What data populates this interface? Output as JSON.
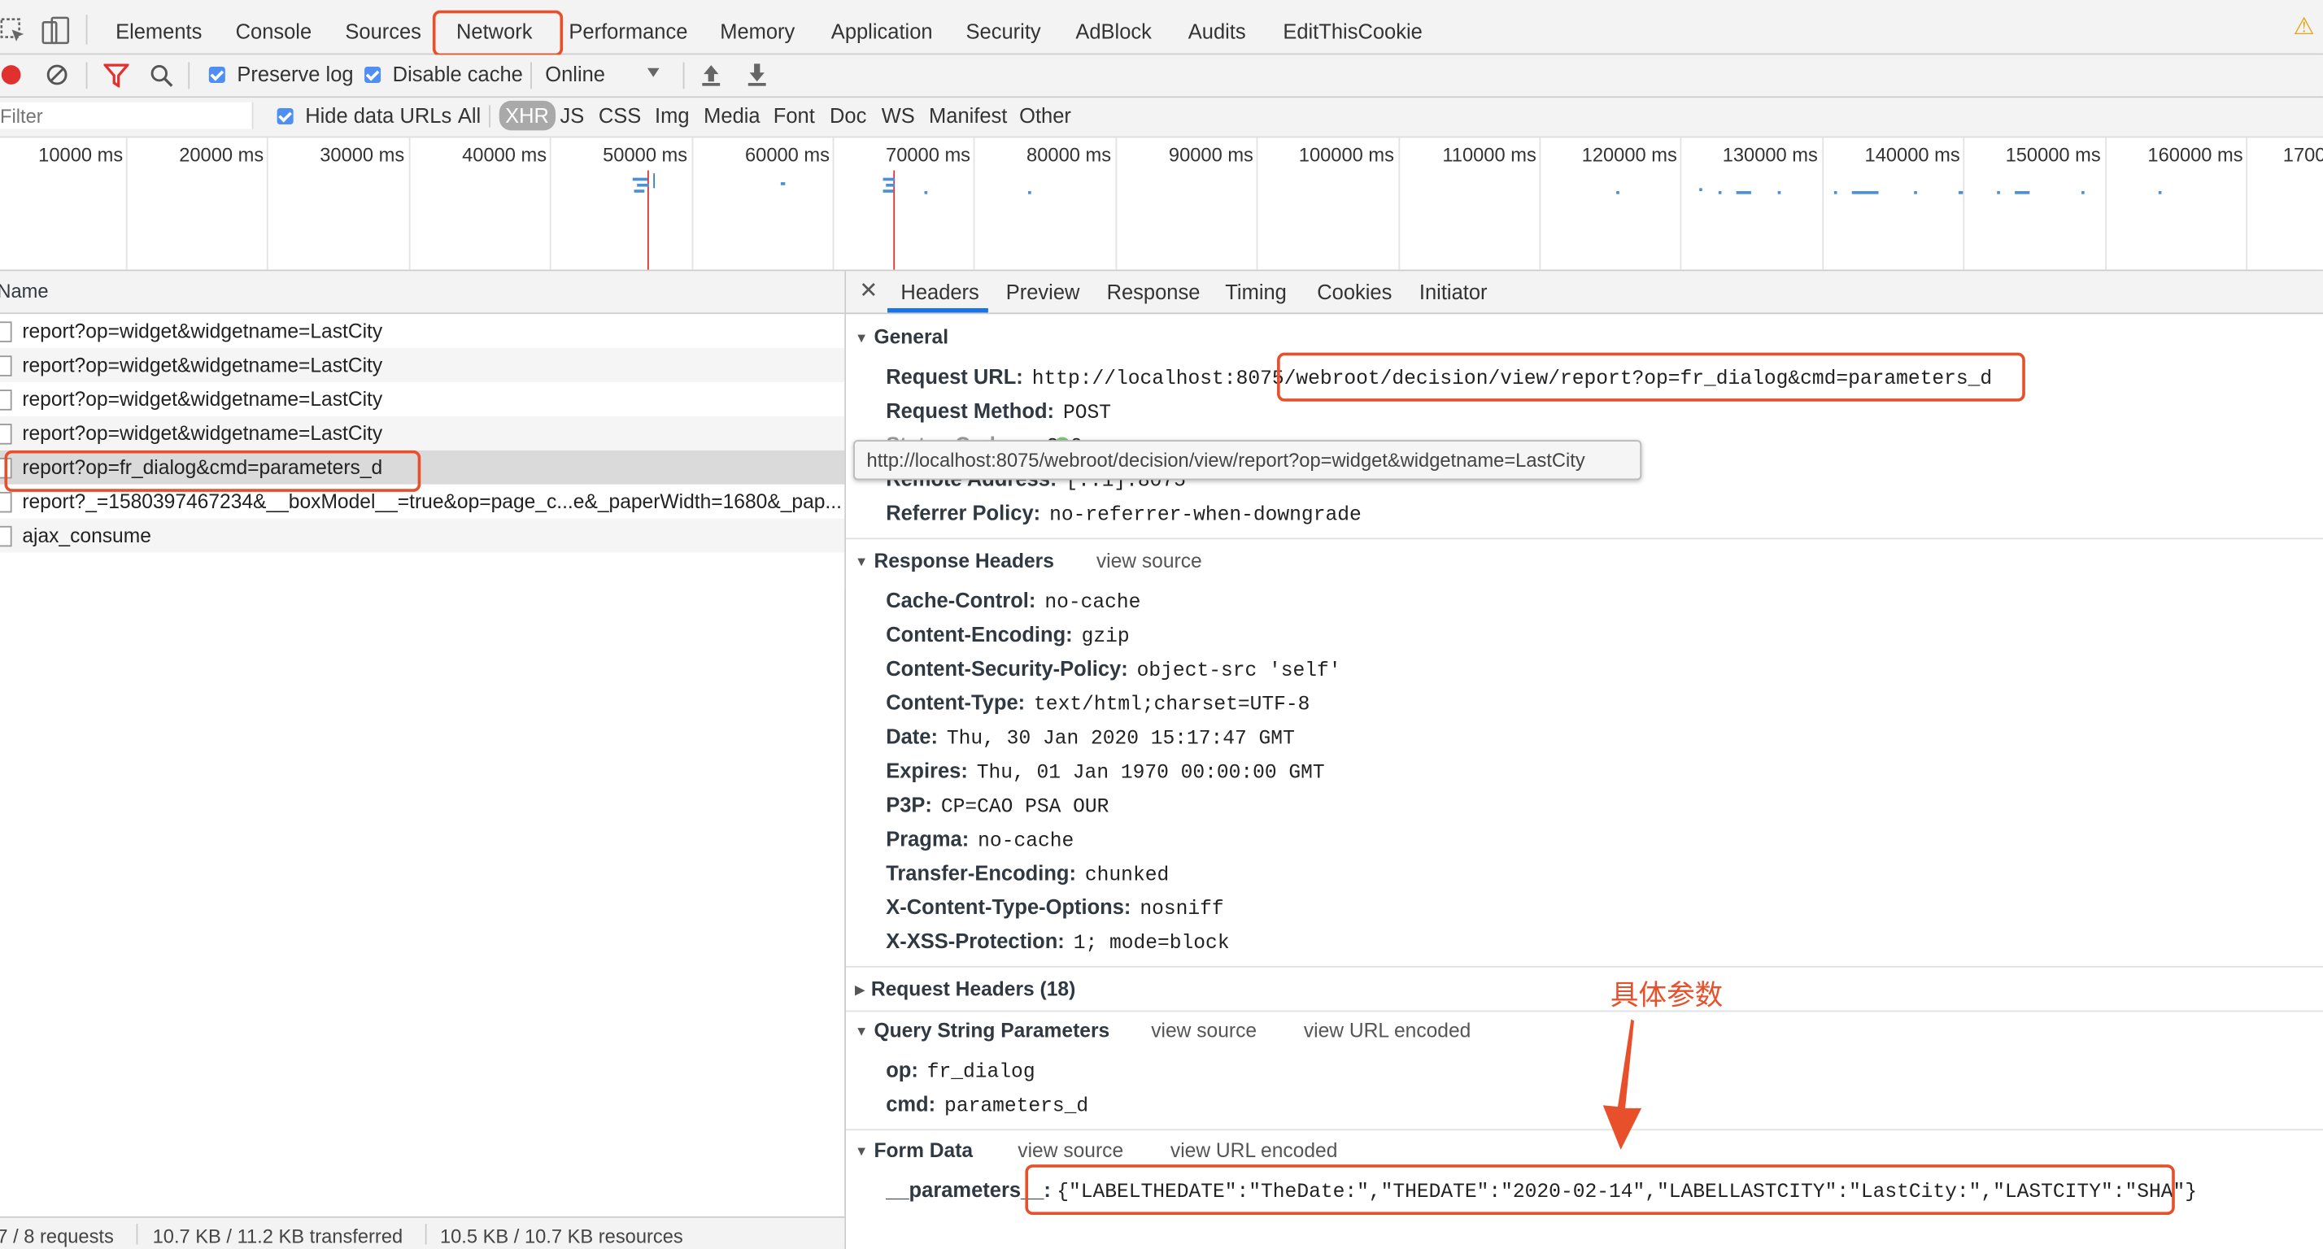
{
  "topbar": {
    "tabs": [
      "Elements",
      "Console",
      "Sources",
      "Network",
      "Performance",
      "Memory",
      "Application",
      "Security",
      "AdBlock",
      "Audits",
      "EditThisCookie"
    ],
    "active_tab": "Network",
    "warning_icon": "⚠"
  },
  "toolbar": {
    "preserve_log": "Preserve log",
    "disable_cache": "Disable cache",
    "throttle": "Online"
  },
  "filterbar": {
    "placeholder": "Filter",
    "hide_data_urls": "Hide data URLs",
    "types": [
      "All",
      "XHR",
      "JS",
      "CSS",
      "Img",
      "Media",
      "Font",
      "Doc",
      "WS",
      "Manifest",
      "Other"
    ],
    "active_type": "XHR"
  },
  "timeline": {
    "ticks": [
      "10000 ms",
      "20000 ms",
      "30000 ms",
      "40000 ms",
      "50000 ms",
      "60000 ms",
      "70000 ms",
      "80000 ms",
      "90000 ms",
      "100000 ms",
      "110000 ms",
      "120000 ms",
      "130000 ms",
      "140000 ms",
      "150000 ms",
      "160000 ms",
      "1700"
    ]
  },
  "requests": {
    "header": "Name",
    "rows": [
      "report?op=widget&widgetname=LastCity",
      "report?op=widget&widgetname=LastCity",
      "report?op=widget&widgetname=LastCity",
      "report?op=widget&widgetname=LastCity",
      "report?op=fr_dialog&cmd=parameters_d",
      "report?_=1580397467234&__boxModel__=true&op=page_c...e&_paperWidth=1680&_pap...",
      "ajax_consume"
    ],
    "selected_index": 4
  },
  "status": {
    "requests": "7 / 8 requests",
    "transferred": "10.7 KB / 11.2 KB transferred",
    "resources": "10.5 KB / 10.7 KB resources"
  },
  "detail_tabs": [
    "Headers",
    "Preview",
    "Response",
    "Timing",
    "Cookies",
    "Initiator"
  ],
  "detail_active": "Headers",
  "general": {
    "title": "General",
    "request_url_key": "Request URL:",
    "request_url_host": "http://localhost:8075/",
    "request_url_path": "webroot/decision/view/report?op=fr_dialog&cmd=parameters_d",
    "method_key": "Request Method:",
    "method_val": "POST",
    "status_key": "Status Code:",
    "status_val": "200",
    "remote_key": "Remote Address:",
    "remote_val": "[::1]:8075",
    "referrer_key": "Referrer Policy:",
    "referrer_val": "no-referrer-when-downgrade"
  },
  "tooltip": "http://localhost:8075/webroot/decision/view/report?op=widget&widgetname=LastCity",
  "response_headers": {
    "title": "Response Headers",
    "view_source": "view source",
    "items": [
      {
        "k": "Cache-Control:",
        "v": "no-cache"
      },
      {
        "k": "Content-Encoding:",
        "v": "gzip"
      },
      {
        "k": "Content-Security-Policy:",
        "v": "object-src 'self'"
      },
      {
        "k": "Content-Type:",
        "v": "text/html;charset=UTF-8"
      },
      {
        "k": "Date:",
        "v": "Thu, 30 Jan 2020 15:17:47 GMT"
      },
      {
        "k": "Expires:",
        "v": "Thu, 01 Jan 1970 00:00:00 GMT"
      },
      {
        "k": "P3P:",
        "v": "CP=CAO PSA OUR"
      },
      {
        "k": "Pragma:",
        "v": "no-cache"
      },
      {
        "k": "Transfer-Encoding:",
        "v": "chunked"
      },
      {
        "k": "X-Content-Type-Options:",
        "v": "nosniff"
      },
      {
        "k": "X-XSS-Protection:",
        "v": "1; mode=block"
      }
    ]
  },
  "request_headers": {
    "title": "Request Headers (18)"
  },
  "query_params": {
    "title": "Query String Parameters",
    "view_source": "view source",
    "view_url_encoded": "view URL encoded",
    "items": [
      {
        "k": "op:",
        "v": "fr_dialog"
      },
      {
        "k": "cmd:",
        "v": "parameters_d"
      }
    ]
  },
  "form_data": {
    "title": "Form Data",
    "view_source": "view source",
    "view_url_encoded": "view URL encoded",
    "key": "__parameters__:",
    "value": "{\"LABELTHEDATE\":\"TheDate:\",\"THEDATE\":\"2020-02-14\",\"LABELLASTCITY\":\"LastCity:\",\"LASTCITY\":\"SHA\"}"
  },
  "annotation": "具体参数",
  "colors": {
    "highlight": "#e8502c",
    "checkbox": "#4f8ff3",
    "record": "#e0312e"
  }
}
